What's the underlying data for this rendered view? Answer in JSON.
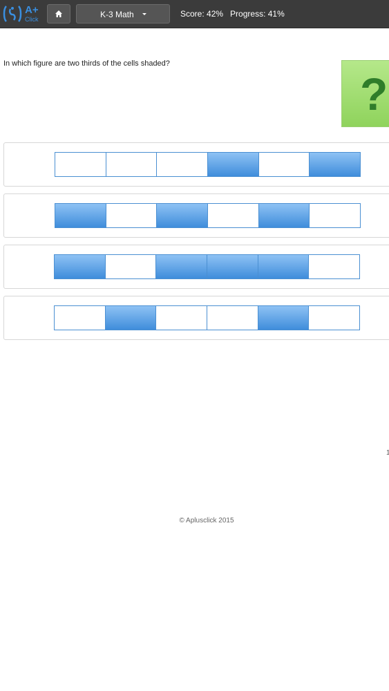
{
  "header": {
    "logo": {
      "main": "A+",
      "sub": "Click"
    },
    "home_icon": "home-icon",
    "subject": "K-3 Math",
    "score": "Score: 42%",
    "progress": "Progress: 41%"
  },
  "question": {
    "text": "In which figure are two thirds of the cells shaded?",
    "help_mark": "?"
  },
  "options": [
    {
      "cells": [
        false,
        false,
        false,
        true,
        false,
        true
      ]
    },
    {
      "cells": [
        true,
        false,
        true,
        false,
        true,
        false
      ]
    },
    {
      "cells": [
        true,
        false,
        true,
        true,
        true,
        false
      ]
    },
    {
      "cells": [
        false,
        true,
        false,
        false,
        true,
        false
      ]
    }
  ],
  "edge_text": "1",
  "footer": "© Aplusclick 2015",
  "colors": {
    "topbar": "#3b3b3b",
    "accent": "#3a8fe0",
    "shaded_cell": "#3f8ddb",
    "help_box": "#8fd35c"
  }
}
